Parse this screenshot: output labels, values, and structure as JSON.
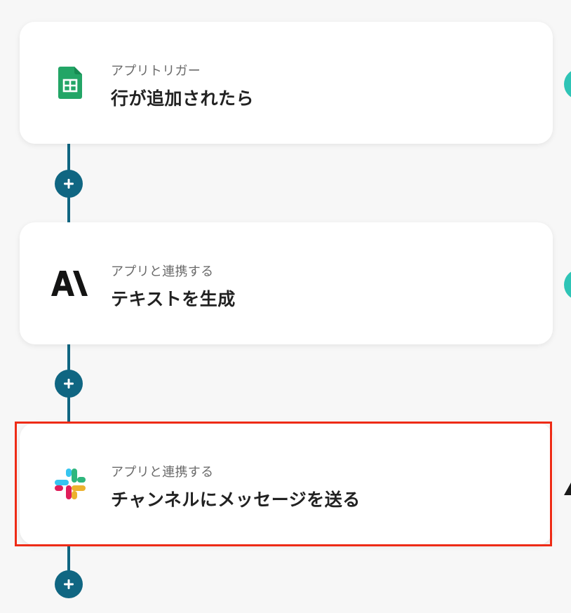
{
  "flow": {
    "steps": [
      {
        "subtitle": "アプリトリガー",
        "title": "行が追加されたら",
        "icon": "google-sheets-icon"
      },
      {
        "subtitle": "アプリと連携する",
        "title": "テキストを生成",
        "icon": "anthropic-icon"
      },
      {
        "subtitle": "アプリと連携する",
        "title": "チャンネルにメッセージを送る",
        "icon": "slack-icon"
      }
    ],
    "add_buttons": [
      "add-step-icon",
      "add-step-icon",
      "add-step-icon"
    ]
  },
  "colors": {
    "connector": "#106682",
    "side_indicator": "#2ec4b6",
    "highlight": "#ee2b16",
    "sheets_green": "#23a566"
  }
}
